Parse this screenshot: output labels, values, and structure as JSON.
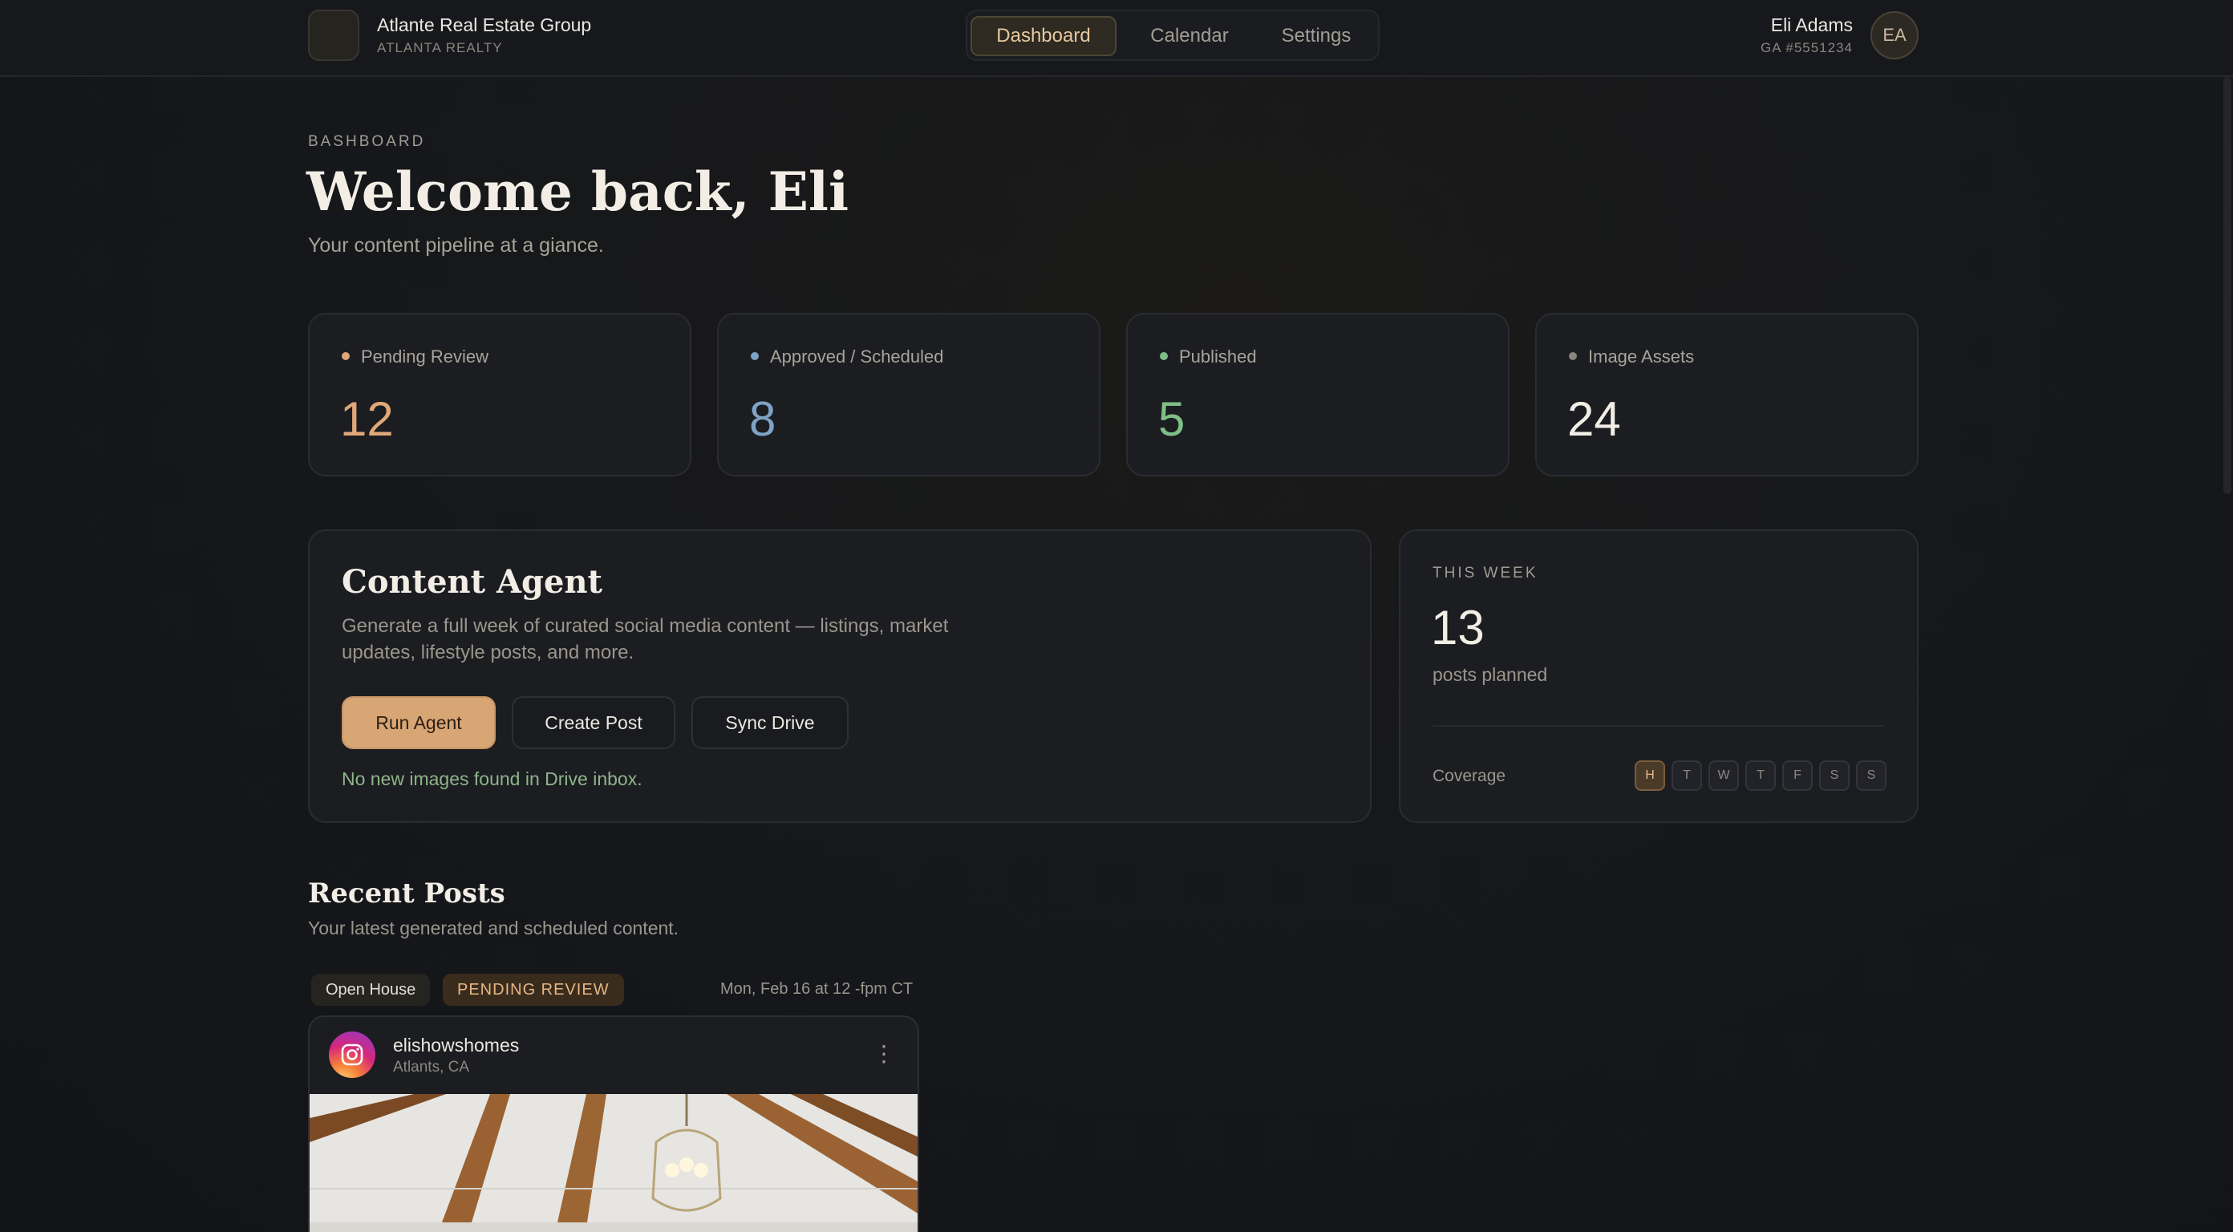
{
  "brand": {
    "name": "Atlante Real Estate Group",
    "subtitle": "ATLANTA REALTY"
  },
  "nav": {
    "tabs": [
      {
        "label": "Dashboard",
        "active": true
      },
      {
        "label": "Calendar"
      },
      {
        "label": "Settings"
      }
    ]
  },
  "user": {
    "name": "Eli Adams",
    "license": "GA #5551234",
    "initials": "EA"
  },
  "header": {
    "eyebrow": "BASHBOARD",
    "title": "Welcome back, Eli",
    "subtitle": "Your content pipeline at a giance."
  },
  "stats": [
    {
      "label": "Pending Review",
      "value": "12",
      "color": "#e0a877"
    },
    {
      "label": "Approved / Scheduled",
      "value": "8",
      "color": "#7ea3c8"
    },
    {
      "label": "Published",
      "value": "5",
      "color": "#7fbf86"
    },
    {
      "label": "Image Assets",
      "value": "24",
      "color": "#f2eee6",
      "dot_color": "#8a857c"
    }
  ],
  "agent": {
    "title": "Content Agent",
    "description": "Generate a full week of curated social media content — listings, market updates, lifestyle posts, and more.",
    "buttons": {
      "run": "Run Agent",
      "create": "Create Post",
      "sync": "Sync Drive"
    },
    "status": "No new images found in Drive inbox."
  },
  "week": {
    "eyebrow": "THIS WEEK",
    "value": "13",
    "subtitle": "posts planned",
    "coverage_label": "Coverage",
    "days": [
      "H",
      "T",
      "W",
      "T",
      "F",
      "S",
      "S"
    ]
  },
  "recent": {
    "title": "Recent Posts",
    "subtitle": "Your latest generated and scheduled content.",
    "post": {
      "type": "Open House",
      "status": "PENDING REVIEW",
      "time": "Mon, Feb 16 at 12 -fpm CT",
      "username": "elishowshomes",
      "location": "Atlants, CA",
      "more_icon": "more-vertical-icon",
      "platform_icon": "instagram-icon"
    }
  },
  "colors": {
    "accent": "#d8a574",
    "background": "#15171b",
    "card": "#1c1d21"
  }
}
